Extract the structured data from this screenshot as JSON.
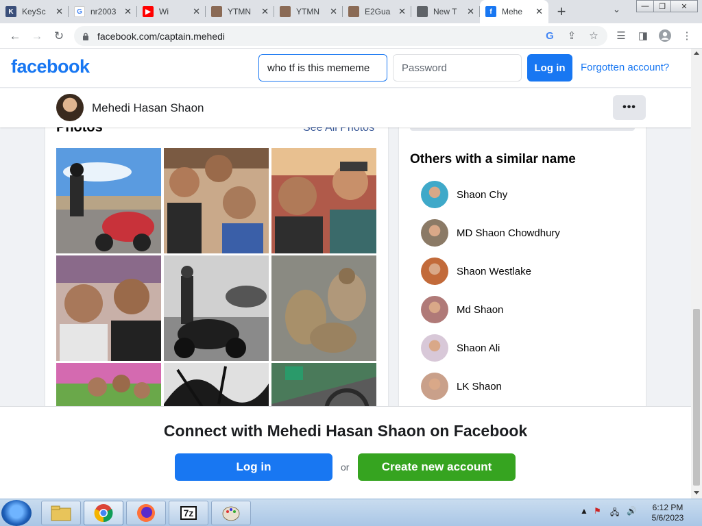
{
  "browser": {
    "tabs": [
      {
        "title": "KeySc",
        "favicon": "keyscore-favicon",
        "color": "#3b4f7a",
        "glyph": "K"
      },
      {
        "title": "nr2003",
        "favicon": "google-favicon",
        "color": "#ffffff",
        "glyph": "G"
      },
      {
        "title": "Wi",
        "favicon": "youtube-favicon",
        "color": "#ff0000",
        "glyph": "▶"
      },
      {
        "title": "YTMN",
        "favicon": "person-favicon",
        "color": "#8a6a55",
        "glyph": ""
      },
      {
        "title": "YTMN",
        "favicon": "person-favicon",
        "color": "#8a6a55",
        "glyph": ""
      },
      {
        "title": "E2Gua",
        "favicon": "person-favicon",
        "color": "#8a6a55",
        "glyph": ""
      },
      {
        "title": "New T",
        "favicon": "chrome-favicon",
        "color": "#5f6368",
        "glyph": ""
      },
      {
        "title": "Mehe",
        "favicon": "facebook-favicon",
        "color": "#1877f2",
        "glyph": "f"
      }
    ],
    "url": "facebook.com/captain.mehedi"
  },
  "header": {
    "logo": "facebook",
    "search_value": "who tf is this mememe",
    "password_placeholder": "Password",
    "login_label": "Log in",
    "forgot_label": "Forgotten account?"
  },
  "profile": {
    "name": "Mehedi Hasan Shaon",
    "more_label": "•••"
  },
  "photos": {
    "title": "Photos",
    "see_all": "See All Photos"
  },
  "similar": {
    "title": "Others with a similar name",
    "people": [
      {
        "name": "Shaon Chy",
        "avatar_color": "#3fa9c9"
      },
      {
        "name": "MD Shaon Chowdhury",
        "avatar_color": "#8b7a66"
      },
      {
        "name": "Shaon Westlake",
        "avatar_color": "#c26a3a"
      },
      {
        "name": "Md Shaon",
        "avatar_color": "#b07a78"
      },
      {
        "name": "Shaon Ali",
        "avatar_color": "#d8c8d8"
      },
      {
        "name": "LK Shaon",
        "avatar_color": "#c9a08a"
      }
    ]
  },
  "connect": {
    "title": "Connect with Mehedi Hasan Shaon on Facebook",
    "login_label": "Log in",
    "or_label": "or",
    "create_label": "Create new account"
  },
  "taskbar": {
    "apps": [
      "file-explorer-icon",
      "chrome-icon",
      "firefox-icon",
      "7zip-icon",
      "paint-icon"
    ],
    "sevenzip_label": "7z",
    "time": "6:12 PM",
    "date": "5/6/2023"
  },
  "colors": {
    "facebook_blue": "#1877f2",
    "create_green": "#36a420"
  }
}
